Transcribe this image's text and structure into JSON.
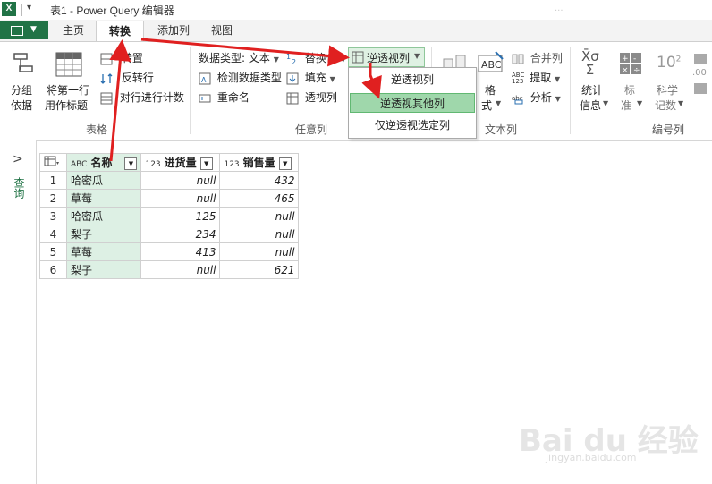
{
  "window": {
    "title": "表1 - Power Query 编辑器",
    "title_right": "...",
    "qa_dropdown": "▾"
  },
  "tabs": [
    {
      "label": "主页"
    },
    {
      "label": "转换",
      "active": true
    },
    {
      "label": "添加列"
    },
    {
      "label": "视图"
    }
  ],
  "ribbon": {
    "table_group": {
      "label": "表格",
      "group_by": [
        "分组",
        "依据"
      ],
      "first_row_headers": [
        "将第一行",
        "用作标题"
      ],
      "transpose": "转置",
      "reverse_rows": "反转行",
      "count_rows": "对行进行计数"
    },
    "any_column_group": {
      "label": "任意列",
      "data_type": "数据类型: 文本",
      "detect_type": "检测数据类型",
      "rename": "重命名",
      "replace_values": "替换值",
      "fill": "填充",
      "pivot": "透视列",
      "unpivot": "逆透视列"
    },
    "text_column_group": {
      "label": "文本列",
      "format": [
        "格",
        "式"
      ],
      "merge": "合并列",
      "extract": "提取",
      "parse": "分析"
    },
    "number_column_group": {
      "label": "编号列",
      "statistics": [
        "统计",
        "信息"
      ],
      "standard": [
        "标",
        "准"
      ],
      "scientific": [
        "科学",
        "记数"
      ]
    }
  },
  "dropdown": {
    "items": [
      "逆透视列",
      "逆透视其他列",
      "仅逆透视选定列"
    ],
    "highlighted_index": 1
  },
  "left_pane": {
    "label": "查询",
    "chevron": ">"
  },
  "grid": {
    "columns": [
      {
        "type": "ABC",
        "name": "名称"
      },
      {
        "type": "123",
        "name": "进货量"
      },
      {
        "type": "123",
        "name": "销售量"
      }
    ],
    "rows": [
      {
        "n": "1",
        "name": "哈密瓜",
        "in": "null",
        "out": "432"
      },
      {
        "n": "2",
        "name": "草莓",
        "in": "null",
        "out": "465"
      },
      {
        "n": "3",
        "name": "哈密瓜",
        "in": "125",
        "out": "null"
      },
      {
        "n": "4",
        "name": "梨子",
        "in": "234",
        "out": "null"
      },
      {
        "n": "5",
        "name": "草莓",
        "in": "413",
        "out": "null"
      },
      {
        "n": "6",
        "name": "梨子",
        "in": "null",
        "out": "621"
      }
    ]
  },
  "watermark": {
    "logo": "Bai du 经验",
    "url": "jingyan.baidu.com"
  },
  "colors": {
    "excel_green": "#217346",
    "selected_column": "#ddf0e4",
    "menu_highlight": "#9fd7ab",
    "annotation_arrow": "#e02020"
  }
}
